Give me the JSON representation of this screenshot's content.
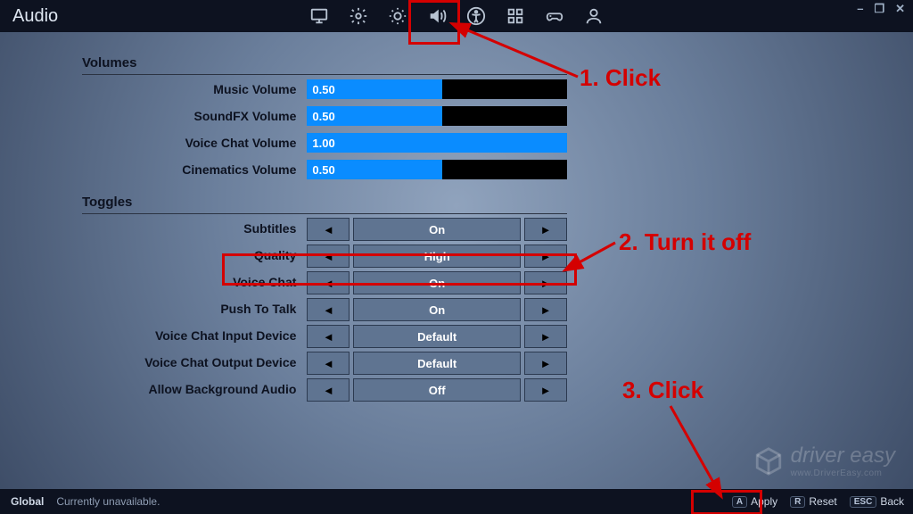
{
  "page_title": "Audio",
  "window_controls": {
    "min": "–",
    "max": "❐",
    "close": "✕"
  },
  "top_icons": [
    "monitor-icon",
    "gear-icon",
    "brightness-icon",
    "audio-icon",
    "accessibility-icon",
    "input-icon",
    "gamepad-icon",
    "account-icon"
  ],
  "sections": {
    "volumes": {
      "heading": "Volumes",
      "rows": [
        {
          "label": "Music Volume",
          "value": "0.50",
          "fill": 50
        },
        {
          "label": "SoundFX Volume",
          "value": "0.50",
          "fill": 50
        },
        {
          "label": "Voice Chat Volume",
          "value": "1.00",
          "fill": 100
        },
        {
          "label": "Cinematics Volume",
          "value": "0.50",
          "fill": 50
        }
      ]
    },
    "toggles": {
      "heading": "Toggles",
      "rows": [
        {
          "label": "Subtitles",
          "value": "On"
        },
        {
          "label": "Quality",
          "value": "High"
        },
        {
          "label": "Voice Chat",
          "value": "On"
        },
        {
          "label": "Push To Talk",
          "value": "On"
        },
        {
          "label": "Voice Chat Input Device",
          "value": "Default"
        },
        {
          "label": "Voice Chat Output Device",
          "value": "Default"
        },
        {
          "label": "Allow Background Audio",
          "value": "Off"
        }
      ]
    }
  },
  "bottom": {
    "status_label": "Global",
    "status_text": "Currently unavailable.",
    "actions": [
      {
        "key": "A",
        "label": "Apply"
      },
      {
        "key": "R",
        "label": "Reset"
      },
      {
        "key": "ESC",
        "label": "Back"
      }
    ]
  },
  "watermark": {
    "brand": "driver easy",
    "url": "www.DriverEasy.com"
  },
  "annotations": {
    "step1": "1. Click",
    "step2": "2. Turn it off",
    "step3": "3. Click"
  }
}
